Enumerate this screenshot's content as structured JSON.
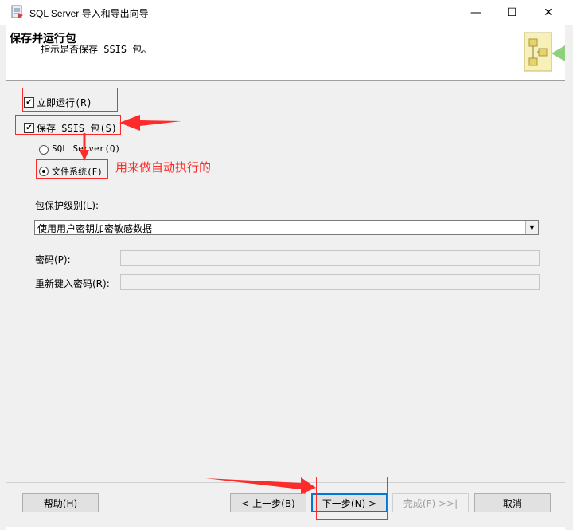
{
  "window": {
    "title": "SQL Server 导入和导出向导",
    "minimize_glyph": "—",
    "maximize_glyph": "☐",
    "close_glyph": "✕"
  },
  "header": {
    "title": "保存并运行包",
    "subtitle": "指示是否保存 SSIS 包。"
  },
  "options": {
    "run_now": {
      "label": "立即运行(R)",
      "checked": true
    },
    "save_ssis": {
      "label": "保存 SSIS 包(S)",
      "checked": true
    },
    "sql_server": {
      "label": "SQL Server(Q)",
      "selected": false
    },
    "file_system": {
      "label": "文件系统(F)",
      "selected": true
    }
  },
  "protection": {
    "label": "包保护级别(L):",
    "value": "使用用户密钥加密敏感数据"
  },
  "password": {
    "label": "密码(P):",
    "value": ""
  },
  "retype_password": {
    "label": "重新键入密码(R):",
    "value": ""
  },
  "annotation": {
    "text": "用来做自动执行的"
  },
  "buttons": {
    "help": "帮助(H)",
    "back": "< 上一步(B)",
    "next": "下一步(N) >",
    "finish": "完成(F) >>|",
    "cancel": "取消"
  },
  "colors": {
    "annotation_red": "#ff2a2a",
    "dialog_bg": "#f0f0f0"
  },
  "icons": [
    "wizard-app-icon",
    "wizard-package-icon"
  ]
}
